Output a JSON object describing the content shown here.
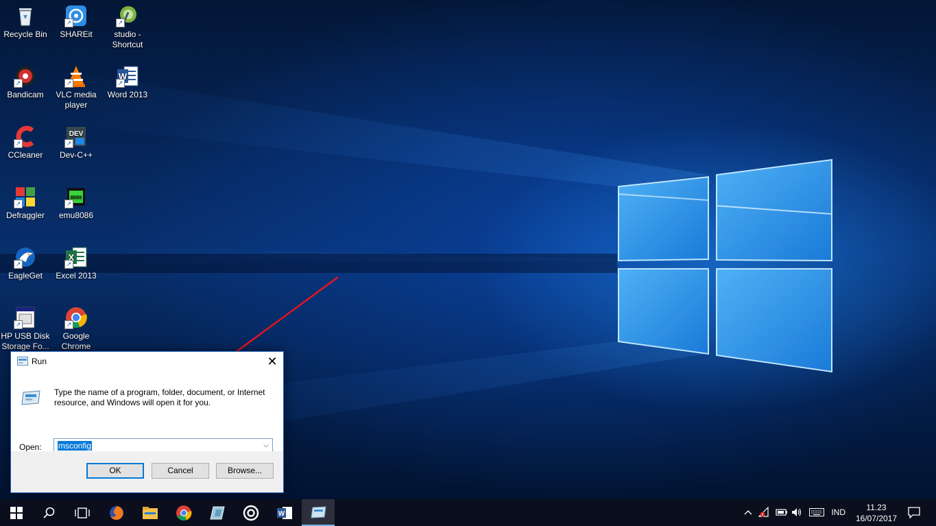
{
  "desktop": {
    "icons": [
      {
        "label": "Recycle Bin",
        "icon": "recycle-bin-icon"
      },
      {
        "label": "SHAREit",
        "icon": "shareit-icon"
      },
      {
        "label": "studio - Shortcut",
        "icon": "android-studio-icon"
      },
      {
        "label": "Bandicam",
        "icon": "bandicam-icon"
      },
      {
        "label": "VLC media player",
        "icon": "vlc-icon"
      },
      {
        "label": "Word 2013",
        "icon": "word-icon"
      },
      {
        "label": "CCleaner",
        "icon": "ccleaner-icon"
      },
      {
        "label": "Dev-C++",
        "icon": "devcpp-icon"
      },
      {
        "label": "Defraggler",
        "icon": "defraggler-icon"
      },
      {
        "label": "emu8086",
        "icon": "emu8086-icon"
      },
      {
        "label": "EagleGet",
        "icon": "eagleget-icon"
      },
      {
        "label": "Excel 2013",
        "icon": "excel-icon"
      },
      {
        "label": "HP USB Disk Storage Fo...",
        "icon": "hp-usb-icon"
      },
      {
        "label": "Google Chrome",
        "icon": "chrome-icon"
      }
    ]
  },
  "run_dialog": {
    "title": "Run",
    "description": "Type the name of a program, folder, document, or Internet resource, and Windows will open it for you.",
    "open_label": "Open:",
    "open_value": "msconfig",
    "ok_label": "OK",
    "cancel_label": "Cancel",
    "browse_label": "Browse..."
  },
  "taskbar": {
    "language": "IND",
    "time": "11.23",
    "date": "16/07/2017"
  },
  "colors": {
    "accent": "#0078d7",
    "annotation": "#e8141c",
    "taskbar": "#0b0e1c"
  }
}
